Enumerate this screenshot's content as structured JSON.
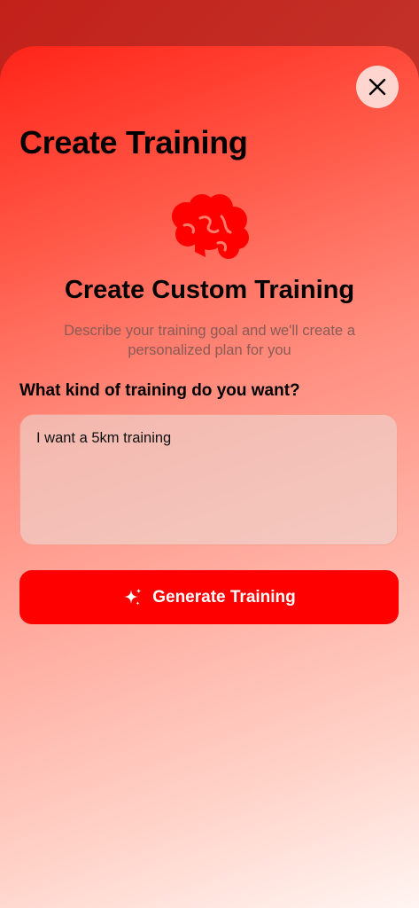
{
  "header": {
    "title": "Create Training",
    "close_icon": "close-icon"
  },
  "hero": {
    "icon": "brain-icon",
    "icon_color": "#ff0000",
    "title": "Create Custom Training",
    "description": "Describe your training goal and we'll create a personalized plan for you"
  },
  "form": {
    "label": "What kind of training do you want?",
    "input_value": "I want a 5km training"
  },
  "action": {
    "icon": "sparkles-icon",
    "label": "Generate Training",
    "color": "#ff0000"
  }
}
